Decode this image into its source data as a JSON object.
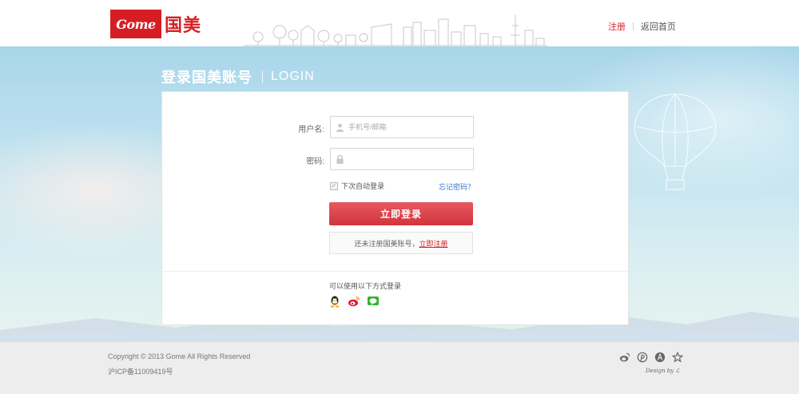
{
  "header": {
    "logo_text": "Gome",
    "logo_cn": "国美",
    "register_link": "注册",
    "separator": "|",
    "home_link": "返回首页"
  },
  "title": {
    "cn": "登录国美账号",
    "en": "LOGIN"
  },
  "form": {
    "username_label": "用户名:",
    "username_placeholder": "手机号/邮箱",
    "username_value": "",
    "password_label": "密码:",
    "password_value": "",
    "remember_label": "下次自动登录",
    "remember_checked": true,
    "forgot_link": "忘记密码？",
    "login_button": "立即登录",
    "no_account_text": "还未注册国美账号，",
    "register_now_link": "立即注册"
  },
  "social": {
    "heading": "可以使用以下方式登录",
    "providers": [
      "qq-icon",
      "weibo-icon",
      "wechat-icon"
    ]
  },
  "footer": {
    "copyright": "Copyright © 2013 Gome All Rights Reserved",
    "icp": "沪ICP备11009419号",
    "icons": [
      "weibo-icon",
      "pinterest-icon",
      "leaf-icon",
      "star-icon"
    ],
    "design_credit": "Design by ℒ"
  },
  "colors": {
    "brand_red": "#d71d24",
    "link_blue": "#3a79c6",
    "button_red": "#dc3c45",
    "footer_bg": "#ededed"
  }
}
